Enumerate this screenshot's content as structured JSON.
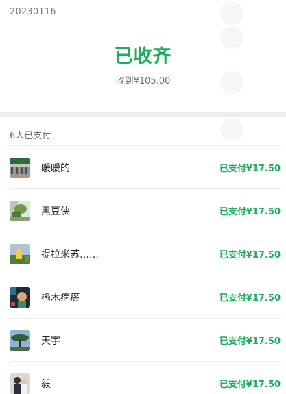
{
  "header": {
    "date": "20230116",
    "status_title": "已收齐",
    "received_text": "收到¥105.00"
  },
  "payments": {
    "count_label": "6人已支付",
    "items": [
      {
        "name": "暖暖的",
        "amount": "已支付¥17.50",
        "avatar_icon": "avatar-photo-building"
      },
      {
        "name": "黑豆侠",
        "amount": "已支付¥17.50",
        "avatar_icon": "avatar-photo-plant"
      },
      {
        "name": "提拉米苏……",
        "amount": "已支付¥17.50",
        "avatar_icon": "avatar-photo-person"
      },
      {
        "name": "榆木疙瘩",
        "amount": "已支付¥17.50",
        "avatar_icon": "avatar-photo-character"
      },
      {
        "name": "天宇",
        "amount": "已支付¥17.50",
        "avatar_icon": "avatar-photo-tree"
      },
      {
        "name": "毅",
        "amount": "已支付¥17.50",
        "avatar_icon": "avatar-photo-people"
      }
    ]
  },
  "colors": {
    "accent_green": "#1aad5a",
    "band_gray": "#ededed"
  }
}
